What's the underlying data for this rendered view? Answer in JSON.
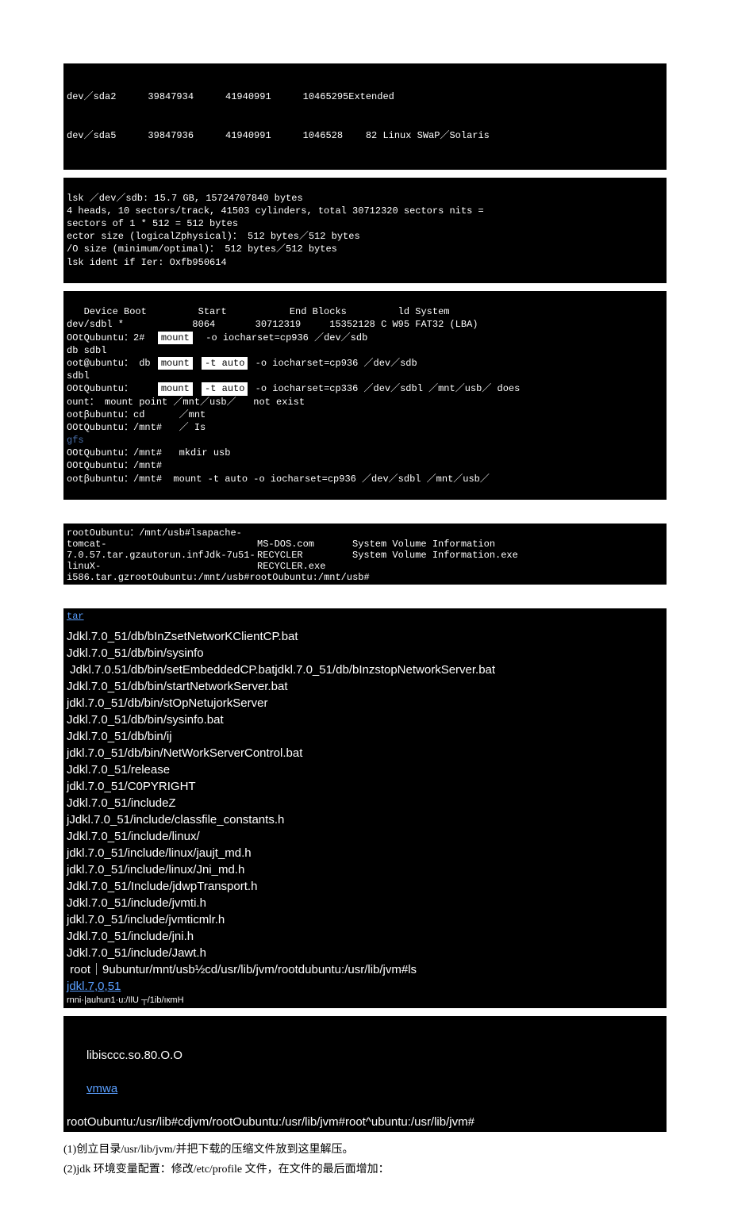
{
  "partition_table": {
    "rows": [
      {
        "dev": "dev／sda2",
        "start": "39847934",
        "end": "41940991",
        "blocks": "10465295Extended"
      },
      {
        "dev": "dev／sda5",
        "start": "39847936",
        "end": "41940991",
        "blocks": "1046528    82 Linux SWaP／Solaris"
      }
    ]
  },
  "disk_info": {
    "l1": "lsk ／dev／sdb: 15.7 GB, 15724707840 bytes",
    "l2": "4 heads, 10 sectors/track, 41503 cylinders, total 30712320 sectors nits =",
    "l3": "sectors of 1 * 512 = 512 bytes",
    "l4": "ector size (logicalZphysical)： 512 bytes／512 bytes",
    "l5": "/O size (minimum/optimal)： 512 bytes／512 bytes",
    "l6": "lsk ident if Ier: Oxfb950614"
  },
  "device_section": {
    "h1": "   Device Boot         Start           End Blocks         ld System",
    "r1": "dev/sdbl *            8064       30712319     15352128 C W95 FAT32 (LBA)",
    "r2_l": "OOtQubuntu：2#",
    "r2_m": "mount",
    "r2_r": "-o iocharset=cp936 ／dev／sdb",
    "r3": "db sdbl",
    "r4_l": "oot@ubuntu： db",
    "r4_m": "mount",
    "r4_m2": "-t auto",
    "r4_r": "-o iocharset=cp936 ／dev／sdb",
    "r5": "sdbl",
    "r6_l": "OOtQubuntu：",
    "r6_m": "mount",
    "r6_m2": "-t auto",
    "r6_r": "-o iocharset=cp336 ／dev／sdbl ／mnt／usb／ does",
    "r7_l": "ount： mount point ／mnt／usb／",
    "r7_r": "not exist",
    "r8": "ootβubuntu：cd      ／mnt",
    "r9": "OOtQubuntu：/mnt#   ／ Is",
    "r10": "gfs",
    "r11": "OOtQubuntu：/mnt#   mkdir usb",
    "r12": "OOtQubuntu：/mnt#",
    "r13": "ootβubuntu：/mnt#  mount -t auto -o iocharset=cp936 ／dev／sdbl ／mnt／usb／"
  },
  "ls_block": {
    "prompt": "  rootOubuntu：/mnt/usb#ls",
    "c1_1": "apache-",
    "c1_2": "tomcat-",
    "c1_3": "7.0.57.tar.gzautorun.infJdk-7u51-",
    "c1_4": "linuX-",
    "c1_5": "i586.tar.gz",
    "c2_1": "MS-DOS.com",
    "c2_2": "RECYCLER",
    "c2_3": "RECYCLER.exe",
    "c3_1": "System Volume Information",
    "c3_2": "System Volume Information.exe",
    "final": "rootOubuntu:/mnt/usb#rootOubuntu:/mnt/usb#",
    "final_path_hint": "/mnt/"
  },
  "tar_block": {
    "header": "tar",
    "lines": [
      "Jdkl.7.0_51/db/bInZsetNetworKClientCP.bat",
      "Jdkl.7.0_51/db/bin/sysinfo",
      " Jdkl.7.0.51/db/bin/setEmbeddedCP.batjdkl.7.0_51/db/bInzstopNetworkServer.bat",
      "Jdkl.7.0_51/db/bin/startNetworkServer.bat",
      "jdkl.7.0_51/db/bin/stOpNetujorkServer",
      "Jdkl.7.0_51/db/bin/sysinfo.bat",
      "Jdkl.7.0_51/db/bin/ij",
      "jdkl.7.0_51/db/bin/NetWorkServerControl.bat",
      "Jdkl.7.0_51/release",
      "jdkl.7.0_51/C0PYRIGHT",
      "Jdkl.7.0_51/includeZ",
      "jJdkl.7.0_51/include/classfile_constants.h",
      "Jdkl.7.0_51/include/linux/",
      "jdkl.7.0_51/include/linux/jaujt_md.h",
      "jdkl.7.0_51/include/linux/Jni_md.h",
      "Jdkl.7.0_51/Include/jdwpTransport.h",
      "Jdkl.7.0_51/include/jvmti.h",
      "jdkl.7.0_51/include/jvmticmlr.h",
      "Jdkl.7.0_51/include/jni.h",
      "Jdkl.7.0_51/include/Jawt.h"
    ],
    "prompt_line": " root｜9ubuntur/mnt/usb½cd/usr/lib/jvm/rootdubuntu:/usr/lib/jvm#ls",
    "jdk_line": "jdkl.7,0,51",
    "rnni_line": "rnni·|auhun1·u:/IlU ┬/1ib/ıкmH"
  },
  "final_block": {
    "lib": "libisccc.so.80.O.O",
    "vmwa": "vmwa",
    "prompt": "rootOubuntu:/usr/lib#cdjvm/rootOubuntu:/usr/lib/jvm#root^ubuntu:/usr/lib/jvm#"
  },
  "chinese": {
    "line1": "(1)创立目录/usr/lib/jvm/并把下载的压缩文件放到这里解压。",
    "line2": "(2)jdk 环境变量配置：修改/etc/profile 文件，在文件的最后面增加："
  }
}
